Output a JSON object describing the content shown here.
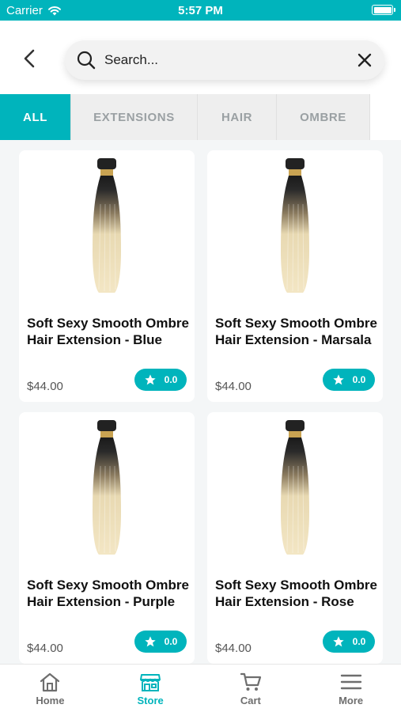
{
  "status_bar": {
    "carrier": "Carrier",
    "time": "5:57 PM"
  },
  "header": {
    "search_placeholder": "Search..."
  },
  "tabs": [
    {
      "label": "ALL",
      "active": true
    },
    {
      "label": "EXTENSIONS",
      "active": false
    },
    {
      "label": "HAIR",
      "active": false
    },
    {
      "label": "OMBRE",
      "active": false
    }
  ],
  "products": [
    {
      "name": "Soft Sexy Smooth Ombre Hair Extension - Blue",
      "price": "$44.00",
      "rating": "0.0"
    },
    {
      "name": "Soft Sexy Smooth Ombre Hair Extension - Marsala",
      "price": "$44.00",
      "rating": "0.0"
    },
    {
      "name": "Soft Sexy Smooth Ombre Hair Extension - Purple",
      "price": "$44.00",
      "rating": "0.0"
    },
    {
      "name": "Soft Sexy Smooth Ombre Hair Extension - Rose",
      "price": "$44.00",
      "rating": "0.0"
    }
  ],
  "bottom_nav": [
    {
      "label": "Home",
      "icon": "home-icon"
    },
    {
      "label": "Store",
      "icon": "store-icon",
      "active": true
    },
    {
      "label": "Cart",
      "icon": "cart-icon"
    },
    {
      "label": "More",
      "icon": "menu-icon"
    }
  ],
  "colors": {
    "accent": "#00b4bc",
    "background": "#f4f6f7"
  }
}
